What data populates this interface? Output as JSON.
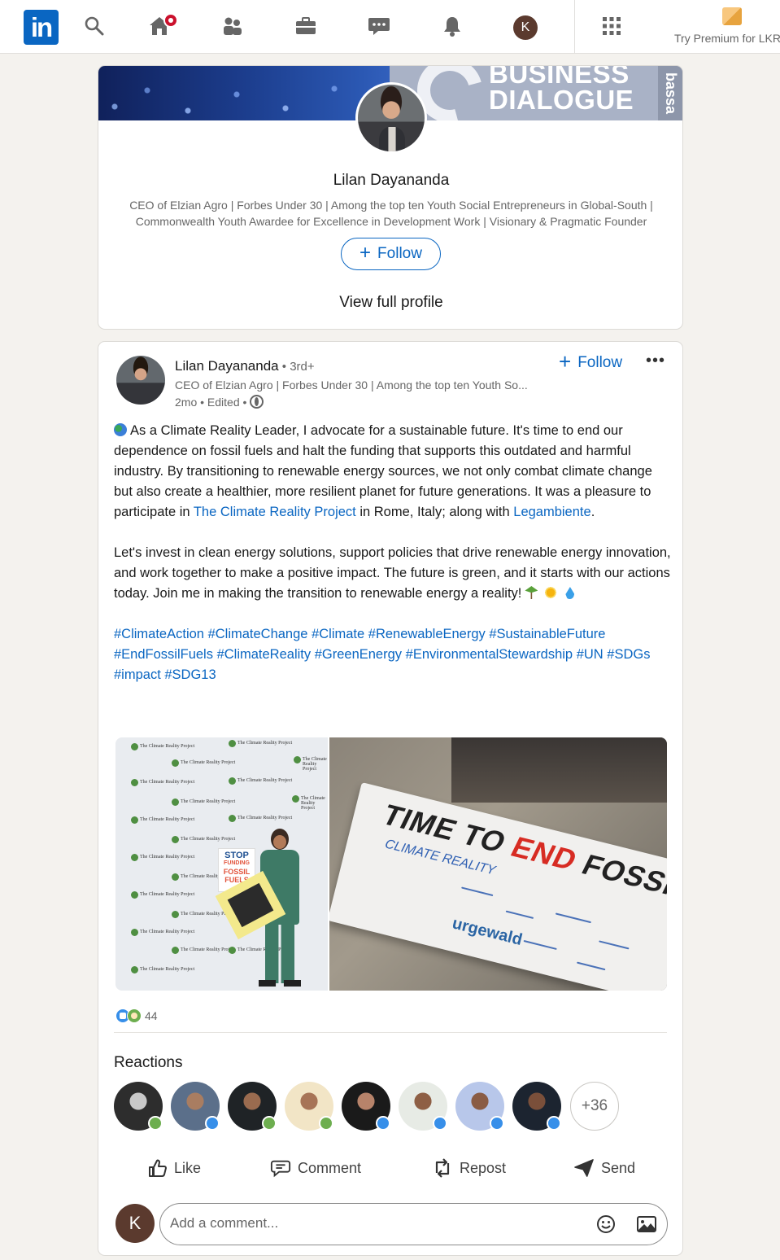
{
  "nav": {
    "logo": "in",
    "avatar_initial": "K",
    "premium_text": "Try Premium for LKR",
    "colors": {
      "brand": "#0a66c2",
      "notification": "#cb112d"
    },
    "icons": [
      "search-icon",
      "home-icon",
      "my-network-icon",
      "jobs-icon",
      "messaging-icon",
      "notifications-icon",
      "me-avatar",
      "apps-grid-icon",
      "premium-icon"
    ]
  },
  "profile_card": {
    "banner_text_line1": "BUSINESS",
    "banner_text_line2": "DIALOGUE",
    "banner_side_text": "bassa",
    "name": "Lilan Dayananda",
    "headline_line1": "CEO of Elzian Agro | Forbes Under 30 | Among the top ten Youth Social Entrepreneurs in Global-South |",
    "headline_line2": "Commonwealth Youth Awardee for Excellence in Development Work | Visionary & Pragmatic Founder",
    "follow_label": "Follow",
    "view_full_profile": "View full profile"
  },
  "post": {
    "author": "Lilan Dayananda",
    "degree": " • 3rd+",
    "headline": "CEO of Elzian Agro | Forbes Under 30 | Among the top ten Youth So...",
    "meta": "2mo • Edited •",
    "follow_label": "Follow",
    "more_label": "•••",
    "body": {
      "p1_a": "As a Climate Reality Leader, I advocate for a sustainable future. It's time to end our dependence on fossil fuels and halt the funding that supports this outdated and harmful industry. By transitioning to renewable energy sources, we not only combat climate change but also create a healthier, more resilient planet for future generations. It was a pleasure to participate in ",
      "link1": "The Climate Reality Project",
      "p1_b": " in Rome, Italy; along with ",
      "link2": "Legambiente",
      "p1_c": ".",
      "p2": "Let's invest in clean energy solutions, support policies that drive renewable energy innovation, and work together to make a positive impact. The future is green, and it starts with our actions today. Join me in making the transition to renewable energy a reality!",
      "hashtags": [
        "#ClimateAction",
        "#ClimateChange",
        "#Climate",
        "#RenewableEnergy",
        "#SustainableFuture",
        "#EndFossilFuels",
        "#ClimateReality",
        "#GreenEnergy",
        "#EnvironmentalStewardship",
        "#UN",
        "#SDGs",
        "#impact",
        "#SDG13"
      ]
    },
    "image_left": {
      "backdrop_label": "The Climate Reality Project",
      "sign_line1": "STOP",
      "sign_line2": "FUNDING",
      "sign_line3": "FOSSIL",
      "sign_line4": "FUELS"
    },
    "image_right": {
      "banner_word1": "TIME TO ",
      "banner_word2": "END",
      "banner_word3": " FOSSIL FUELS",
      "banner_sub": "CLIMATE REALITY",
      "banner_brand": "urgewald"
    },
    "reaction_count": "44",
    "reactions_label": "Reactions",
    "reactors": [
      {
        "badge": "support"
      },
      {
        "badge": "like"
      },
      {
        "badge": "support"
      },
      {
        "badge": "support"
      },
      {
        "badge": "like"
      },
      {
        "badge": "like"
      },
      {
        "badge": "like"
      },
      {
        "badge": "like"
      }
    ],
    "more_reactors": "+36",
    "actions": {
      "like": "Like",
      "comment": "Comment",
      "repost": "Repost",
      "send": "Send"
    },
    "comment_avatar_initial": "K",
    "comment_placeholder": "Add a comment..."
  }
}
